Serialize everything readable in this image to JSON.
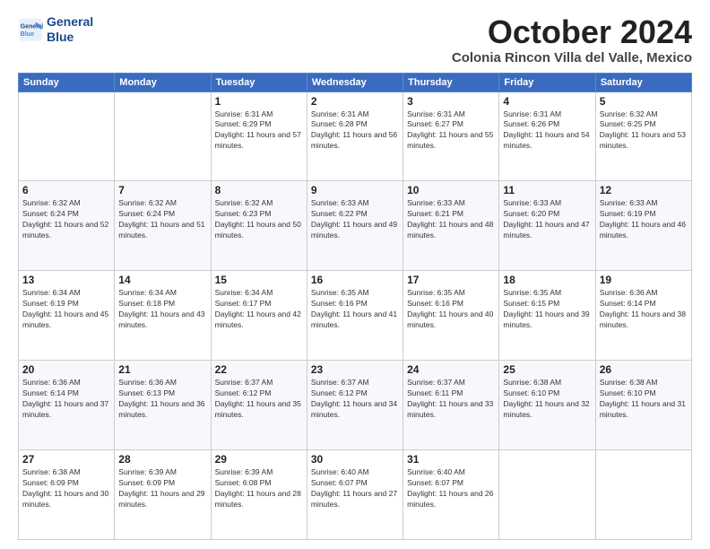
{
  "header": {
    "logo_line1": "General",
    "logo_line2": "Blue",
    "month": "October 2024",
    "location": "Colonia Rincon Villa del Valle, Mexico"
  },
  "days_of_week": [
    "Sunday",
    "Monday",
    "Tuesday",
    "Wednesday",
    "Thursday",
    "Friday",
    "Saturday"
  ],
  "weeks": [
    [
      {
        "day": "",
        "info": ""
      },
      {
        "day": "",
        "info": ""
      },
      {
        "day": "1",
        "info": "Sunrise: 6:31 AM\nSunset: 6:29 PM\nDaylight: 11 hours and 57 minutes."
      },
      {
        "day": "2",
        "info": "Sunrise: 6:31 AM\nSunset: 6:28 PM\nDaylight: 11 hours and 56 minutes."
      },
      {
        "day": "3",
        "info": "Sunrise: 6:31 AM\nSunset: 6:27 PM\nDaylight: 11 hours and 55 minutes."
      },
      {
        "day": "4",
        "info": "Sunrise: 6:31 AM\nSunset: 6:26 PM\nDaylight: 11 hours and 54 minutes."
      },
      {
        "day": "5",
        "info": "Sunrise: 6:32 AM\nSunset: 6:25 PM\nDaylight: 11 hours and 53 minutes."
      }
    ],
    [
      {
        "day": "6",
        "info": "Sunrise: 6:32 AM\nSunset: 6:24 PM\nDaylight: 11 hours and 52 minutes."
      },
      {
        "day": "7",
        "info": "Sunrise: 6:32 AM\nSunset: 6:24 PM\nDaylight: 11 hours and 51 minutes."
      },
      {
        "day": "8",
        "info": "Sunrise: 6:32 AM\nSunset: 6:23 PM\nDaylight: 11 hours and 50 minutes."
      },
      {
        "day": "9",
        "info": "Sunrise: 6:33 AM\nSunset: 6:22 PM\nDaylight: 11 hours and 49 minutes."
      },
      {
        "day": "10",
        "info": "Sunrise: 6:33 AM\nSunset: 6:21 PM\nDaylight: 11 hours and 48 minutes."
      },
      {
        "day": "11",
        "info": "Sunrise: 6:33 AM\nSunset: 6:20 PM\nDaylight: 11 hours and 47 minutes."
      },
      {
        "day": "12",
        "info": "Sunrise: 6:33 AM\nSunset: 6:19 PM\nDaylight: 11 hours and 46 minutes."
      }
    ],
    [
      {
        "day": "13",
        "info": "Sunrise: 6:34 AM\nSunset: 6:19 PM\nDaylight: 11 hours and 45 minutes."
      },
      {
        "day": "14",
        "info": "Sunrise: 6:34 AM\nSunset: 6:18 PM\nDaylight: 11 hours and 43 minutes."
      },
      {
        "day": "15",
        "info": "Sunrise: 6:34 AM\nSunset: 6:17 PM\nDaylight: 11 hours and 42 minutes."
      },
      {
        "day": "16",
        "info": "Sunrise: 6:35 AM\nSunset: 6:16 PM\nDaylight: 11 hours and 41 minutes."
      },
      {
        "day": "17",
        "info": "Sunrise: 6:35 AM\nSunset: 6:16 PM\nDaylight: 11 hours and 40 minutes."
      },
      {
        "day": "18",
        "info": "Sunrise: 6:35 AM\nSunset: 6:15 PM\nDaylight: 11 hours and 39 minutes."
      },
      {
        "day": "19",
        "info": "Sunrise: 6:36 AM\nSunset: 6:14 PM\nDaylight: 11 hours and 38 minutes."
      }
    ],
    [
      {
        "day": "20",
        "info": "Sunrise: 6:36 AM\nSunset: 6:14 PM\nDaylight: 11 hours and 37 minutes."
      },
      {
        "day": "21",
        "info": "Sunrise: 6:36 AM\nSunset: 6:13 PM\nDaylight: 11 hours and 36 minutes."
      },
      {
        "day": "22",
        "info": "Sunrise: 6:37 AM\nSunset: 6:12 PM\nDaylight: 11 hours and 35 minutes."
      },
      {
        "day": "23",
        "info": "Sunrise: 6:37 AM\nSunset: 6:12 PM\nDaylight: 11 hours and 34 minutes."
      },
      {
        "day": "24",
        "info": "Sunrise: 6:37 AM\nSunset: 6:11 PM\nDaylight: 11 hours and 33 minutes."
      },
      {
        "day": "25",
        "info": "Sunrise: 6:38 AM\nSunset: 6:10 PM\nDaylight: 11 hours and 32 minutes."
      },
      {
        "day": "26",
        "info": "Sunrise: 6:38 AM\nSunset: 6:10 PM\nDaylight: 11 hours and 31 minutes."
      }
    ],
    [
      {
        "day": "27",
        "info": "Sunrise: 6:38 AM\nSunset: 6:09 PM\nDaylight: 11 hours and 30 minutes."
      },
      {
        "day": "28",
        "info": "Sunrise: 6:39 AM\nSunset: 6:09 PM\nDaylight: 11 hours and 29 minutes."
      },
      {
        "day": "29",
        "info": "Sunrise: 6:39 AM\nSunset: 6:08 PM\nDaylight: 11 hours and 28 minutes."
      },
      {
        "day": "30",
        "info": "Sunrise: 6:40 AM\nSunset: 6:07 PM\nDaylight: 11 hours and 27 minutes."
      },
      {
        "day": "31",
        "info": "Sunrise: 6:40 AM\nSunset: 6:07 PM\nDaylight: 11 hours and 26 minutes."
      },
      {
        "day": "",
        "info": ""
      },
      {
        "day": "",
        "info": ""
      }
    ]
  ]
}
